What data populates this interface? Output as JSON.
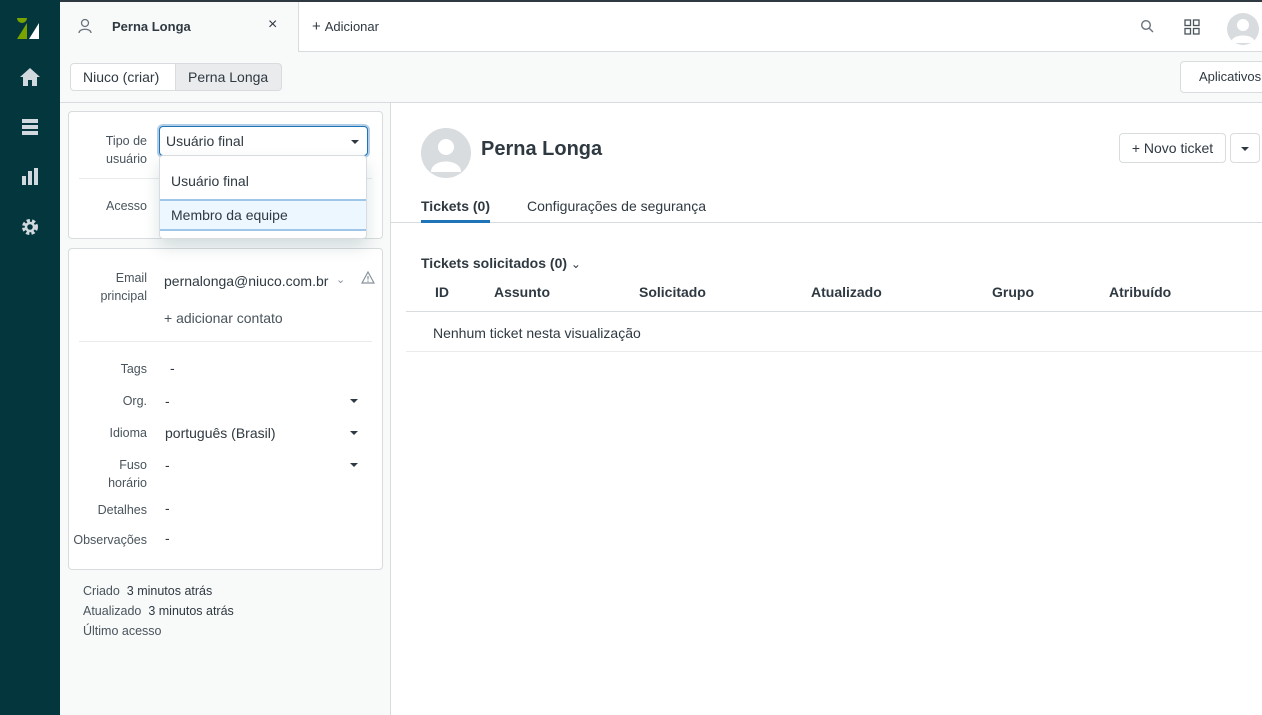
{
  "colors": {
    "rail": "#03363d",
    "accent": "#1f73b7",
    "text": "#2f3941"
  },
  "rail": {
    "icons": [
      "zendesk-logo",
      "home-icon",
      "views-icon",
      "reporting-icon",
      "admin-gear-icon"
    ]
  },
  "topbar": {
    "active_tab": "Perna Longa",
    "add_tab": "Adicionar",
    "icons": [
      "search-icon",
      "product-tray-icon",
      "profile-avatar"
    ]
  },
  "breadcrumb": {
    "items": [
      "Niuco (criar)",
      "Perna Longa"
    ],
    "apps_button": "Aplicativos"
  },
  "user_panel": {
    "user_type": {
      "label_line1": "Tipo de",
      "label_line2": "usuário",
      "value": "Usuário final",
      "options": [
        "Usuário final",
        "Membro da equipe"
      ],
      "highlighted_option": "Membro da equipe"
    },
    "access_label": "Acesso",
    "email": {
      "label_line1": "Email",
      "label_line2": "principal",
      "value": "pernalonga@niuco.com.br"
    },
    "add_contact": "+ adicionar contato",
    "fields": {
      "tags": {
        "label": "Tags",
        "value": "-"
      },
      "org": {
        "label": "Org.",
        "value": "-"
      },
      "language": {
        "label": "Idioma",
        "value": "português (Brasil)"
      },
      "timezone": {
        "label_line1": "Fuso",
        "label_line2": "horário",
        "value": "-"
      },
      "details": {
        "label": "Detalhes",
        "value": "-"
      },
      "notes": {
        "label": "Observações",
        "value": "-"
      }
    },
    "meta": {
      "created_label": "Criado",
      "created_value": "3 minutos atrás",
      "updated_label": "Atualizado",
      "updated_value": "3 minutos atrás",
      "last_access_label": "Último acesso"
    }
  },
  "main": {
    "user_name": "Perna Longa",
    "new_ticket_button": "+ Novo ticket",
    "tabs": [
      "Tickets (0)",
      "Configurações de segurança"
    ],
    "section_title": "Tickets solicitados (0)",
    "columns": [
      "ID",
      "Assunto",
      "Solicitado",
      "Atualizado",
      "Grupo",
      "Atribuído"
    ],
    "empty_message": "Nenhum ticket nesta visualização"
  }
}
